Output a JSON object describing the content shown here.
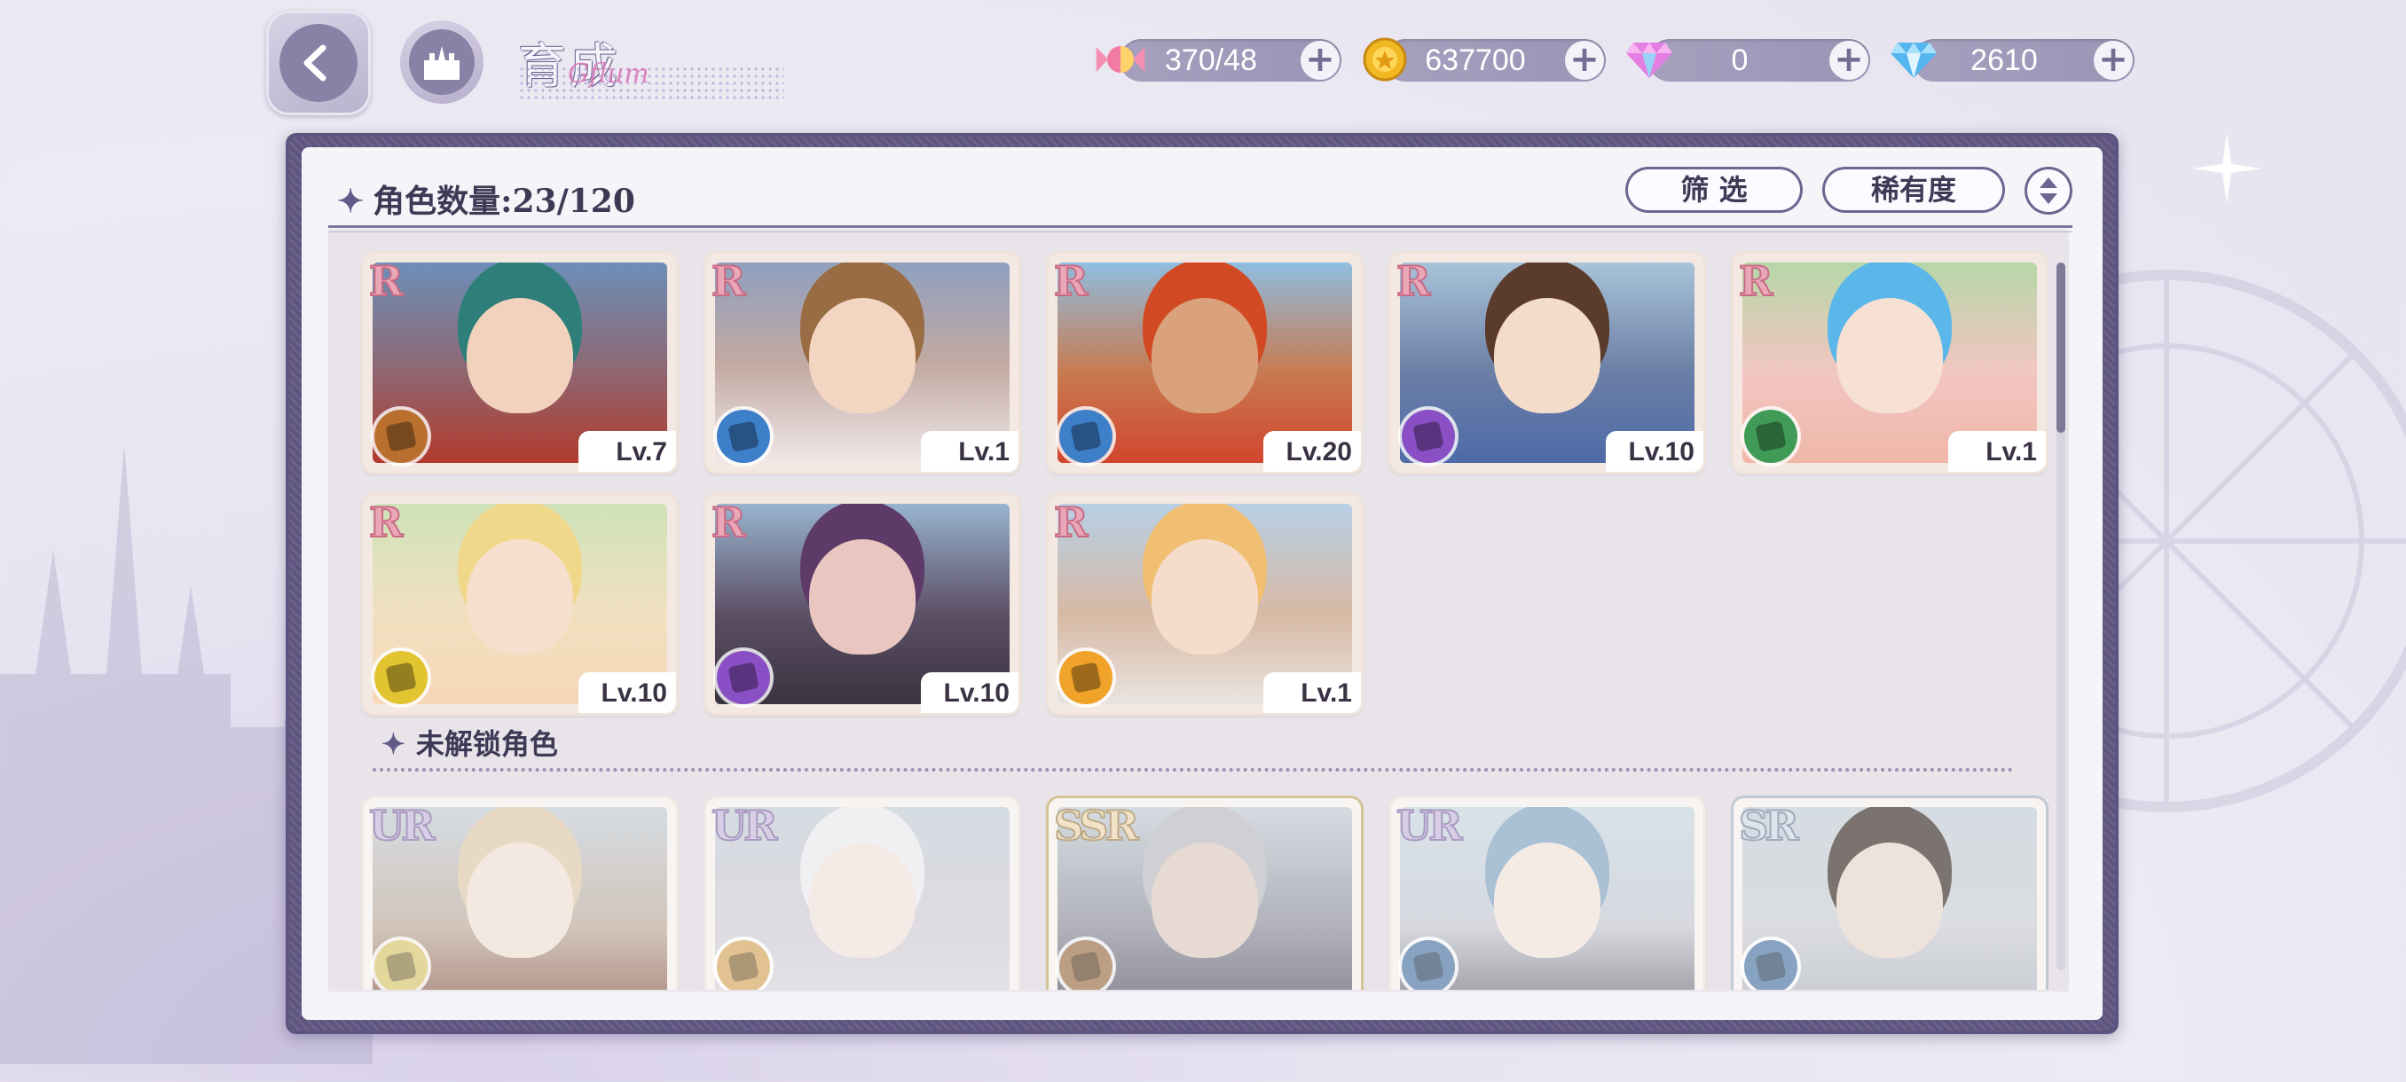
{
  "header": {
    "title": "育成",
    "title_script": "Gflum"
  },
  "resources": [
    {
      "icon": "candy-icon",
      "value": "370/48"
    },
    {
      "icon": "gold-coin-icon",
      "value": "637700"
    },
    {
      "icon": "pink-gem-icon",
      "value": "0"
    },
    {
      "icon": "blue-diamond-icon",
      "value": "2610"
    }
  ],
  "panel": {
    "count_label": "角色数量:",
    "count_value": "23/120",
    "filter_label": "筛 选",
    "rarity_label": "稀有度",
    "locked_section_label": "未解锁角色"
  },
  "owned_cards": [
    {
      "rarity": "R",
      "level": "Lv.7",
      "role_color": "#b9702f"
    },
    {
      "rarity": "R",
      "level": "Lv.1",
      "role_color": "#3d7fc9"
    },
    {
      "rarity": "R",
      "level": "Lv.20",
      "role_color": "#3d7fc9"
    },
    {
      "rarity": "R",
      "level": "Lv.10",
      "role_color": "#8a4fc4"
    },
    {
      "rarity": "R",
      "level": "Lv.1",
      "role_color": "#3f9b56"
    },
    {
      "rarity": "R",
      "level": "Lv.10",
      "role_color": "#e2c431"
    },
    {
      "rarity": "R",
      "level": "Lv.10",
      "role_color": "#8a4fc4"
    },
    {
      "rarity": "R",
      "level": "Lv.1",
      "role_color": "#f0a328"
    }
  ],
  "locked_cards": [
    {
      "rarity": "UR",
      "role_color": "#e2c431"
    },
    {
      "rarity": "UR",
      "role_color": "#f0a328"
    },
    {
      "rarity": "SSR",
      "role_color": "#b9702f"
    },
    {
      "rarity": "UR",
      "role_color": "#3d7fc9"
    },
    {
      "rarity": "SR",
      "role_color": "#3d7fc9"
    }
  ]
}
